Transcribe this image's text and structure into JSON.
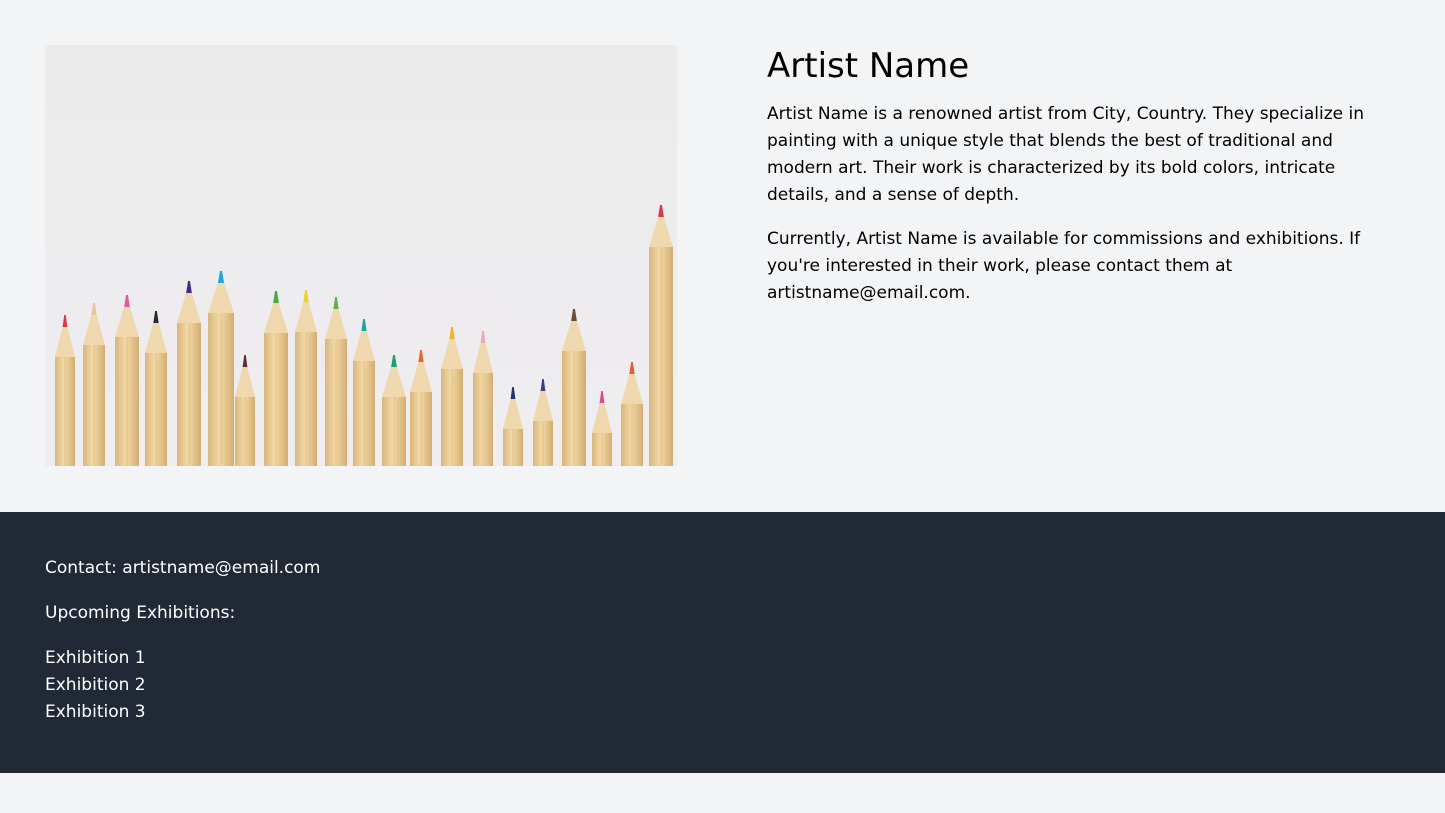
{
  "artist": {
    "name": "Artist Name",
    "bio_paragraph_1": "Artist Name is a renowned artist from City, Country. They specialize in painting with a unique style that blends the best of traditional and modern art. Their work is characterized by its bold colors, intricate details, and a sense of depth.",
    "bio_paragraph_2": "Currently, Artist Name is available for commissions and exhibitions. If you're interested in their work, please contact them at artistname@email.com."
  },
  "image": {
    "subject": "colored-pencils-photo"
  },
  "footer": {
    "contact_text": "Contact: artistname@email.com",
    "exhibitions_heading": "Upcoming Exhibitions:",
    "exhibitions": [
      "Exhibition 1",
      "Exhibition 2",
      "Exhibition 3"
    ]
  },
  "colors": {
    "page_background": "#f3f4f6",
    "footer_background": "#222936",
    "footer_text": "#ffffff",
    "body_text": "#000000"
  }
}
